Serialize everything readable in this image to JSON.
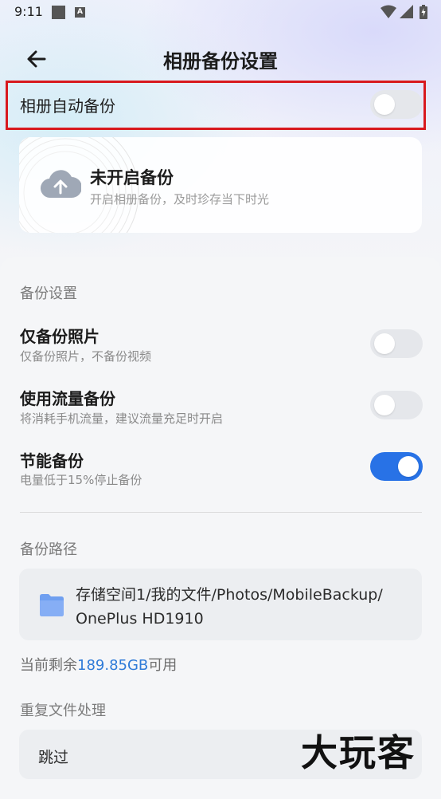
{
  "status_bar": {
    "time": "9:11",
    "a_badge": "A"
  },
  "header": {
    "title": "相册备份设置",
    "back_icon": "arrow-left-icon"
  },
  "auto_backup": {
    "label": "相册自动备份",
    "enabled": false
  },
  "backup_status": {
    "title": "未开启备份",
    "subtitle": "开启相册备份，及时珍存当下时光",
    "icon": "cloud-upload-icon"
  },
  "backup_settings": {
    "section_title": "备份设置",
    "items": [
      {
        "title": "仅备份照片",
        "subtitle": "仅备份照片，不备份视频",
        "enabled": false
      },
      {
        "title": "使用流量备份",
        "subtitle": "将消耗手机流量，建议流量充足时开启",
        "enabled": false
      },
      {
        "title": "节能备份",
        "subtitle": "电量低于15%停止备份",
        "enabled": true
      }
    ]
  },
  "backup_path": {
    "section_title": "备份路径",
    "path_line1": "存储空间1/我的文件/Photos/MobileBackup/",
    "path_line2": "OnePlus HD1910",
    "free_prefix": "当前剩余",
    "free_value": "189.85GB",
    "free_suffix": "可用"
  },
  "duplicate_handling": {
    "section_title": "重复文件处理",
    "value": "跳过"
  },
  "watermark": "大玩客",
  "colors": {
    "accent": "#2872e6",
    "highlight": "#d8191e",
    "link": "#2f7bd8"
  }
}
